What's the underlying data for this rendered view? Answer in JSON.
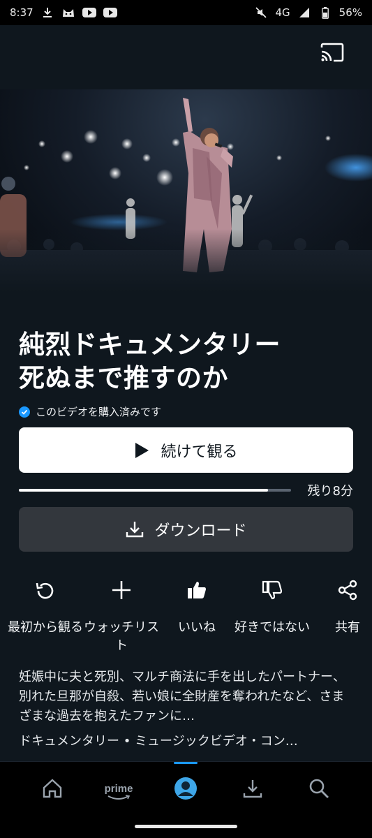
{
  "status_bar": {
    "time": "8:37",
    "network": "4G",
    "battery": "56%",
    "icons": [
      "download-icon",
      "cat-icon",
      "youtube-icon",
      "youtube-icon",
      "mute-icon",
      "signal-icon",
      "battery-icon"
    ]
  },
  "header": {
    "cast_icon": "cast-icon"
  },
  "hero": {
    "image": "concert-performer"
  },
  "title": {
    "line1": "純烈ドキュメンタリー",
    "line2": "死ぬまで推すのか"
  },
  "purchase_status": "このビデオを購入済みです",
  "play_button": {
    "label": "続けて観る"
  },
  "progress": {
    "watched_fraction": 0.915,
    "remaining_label": "残り8分"
  },
  "download_button": {
    "label": "ダウンロード"
  },
  "actions": [
    {
      "label": "最初から観る",
      "icon": "restart-icon"
    },
    {
      "label": "ウォッチリスト",
      "icon": "plus-icon"
    },
    {
      "label": "いいね",
      "icon": "thumbs-up-icon"
    },
    {
      "label": "好きではない",
      "icon": "thumbs-down-icon"
    },
    {
      "label": "共有",
      "icon": "share-icon"
    }
  ],
  "description": "妊娠中に夫と死別、マルチ商法に手を出したパートナー、別れた旦那が自殺、若い娘に全財産を奪われたなど、さまざまな過去を抱えたファンに…",
  "genres": "ドキュメンタリー • ミュージックビデオ・コン…",
  "bottom_nav": {
    "items": [
      {
        "name": "home",
        "icon": "home-icon"
      },
      {
        "name": "prime",
        "label": "prime",
        "icon": "prime-icon"
      },
      {
        "name": "profile",
        "icon": "profile-icon",
        "active": true
      },
      {
        "name": "downloads",
        "icon": "download-icon"
      },
      {
        "name": "search",
        "icon": "search-icon"
      }
    ]
  },
  "colors": {
    "background": "#0f171e",
    "accent": "#1a98ff",
    "secondary_button": "#33373d"
  }
}
